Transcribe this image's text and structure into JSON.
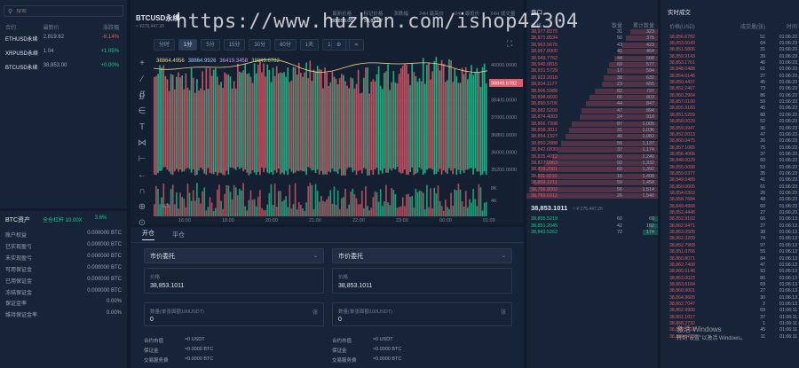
{
  "search": {
    "placeholder": "搜索"
  },
  "market": {
    "headers": [
      "合约",
      "最新价",
      "涨跌幅"
    ],
    "rows": [
      {
        "symbol": "ETHUSD永续",
        "price": "2,819.62",
        "change": "-6.14%",
        "dir": "down"
      },
      {
        "symbol": "XRPUSD永续",
        "price": "1.04",
        "change": "+1.05%",
        "dir": "up"
      },
      {
        "symbol": "BTCUSD永续",
        "price": "38,853.00",
        "change": "+0.00%",
        "dir": "up"
      }
    ]
  },
  "assets": {
    "title": "BTC资产",
    "stats": [
      "全仓杠杆 10.00X",
      "3.6%"
    ],
    "rows": [
      {
        "label": "账户权益",
        "value": "0.000000 BTC"
      },
      {
        "label": "已实现盈亏",
        "value": "0.000000 BTC"
      },
      {
        "label": "未实现盈亏",
        "value": "0.000000 BTC"
      },
      {
        "label": "可用保证金",
        "value": "0.000000 BTC"
      },
      {
        "label": "已用保证金",
        "value": "0.000000 BTC"
      },
      {
        "label": "冻结保证金",
        "value": "0.000000 BTC"
      },
      {
        "label": "保证金率",
        "value": "0.00%"
      },
      {
        "label": "维持保证金率",
        "value": "0.00%"
      }
    ]
  },
  "chart": {
    "symbol": "BTCUSD永续",
    "sub_price": "≈ ¥275,447.20",
    "header_stats": [
      "最新价格",
      "标记价格",
      "涨跌幅",
      "24H 最高价",
      "24H 最低价",
      "24H 成交量"
    ],
    "header_values": [
      "38,853.00",
      "38,852.7",
      "",
      "",
      "",
      ""
    ],
    "intervals": [
      "分时",
      "1分",
      "5分",
      "15分",
      "30分",
      "60分",
      "1天",
      "1周",
      "1月"
    ],
    "active_interval": "1分",
    "ma_values": [
      "38864.4956",
      "38864.9926",
      "36419.3458",
      "38849.6782"
    ],
    "ma_colors": [
      "#f0d38a",
      "#9ad1f5",
      "#d59cf0",
      "#8fe08a"
    ],
    "yaxis": [
      "40000.0000",
      "39200.0000",
      "38400.0000",
      "37600.0000",
      "36800.0000",
      "36000.0000",
      "35200.0000"
    ],
    "price_tag": "38849.6782",
    "xaxis": [
      "16:00",
      "18:00",
      "20:00",
      "21:00",
      "22:00",
      "23:00",
      "00:00",
      "01:00"
    ],
    "vol_axis": [
      "8K",
      "4K"
    ],
    "vol_label": "VOL"
  },
  "order": {
    "tabs": [
      "开仓",
      "平仓"
    ],
    "active_tab": "开仓",
    "forms": [
      {
        "type": "市价委托",
        "price_label": "价格",
        "price_value": "38,853.1011",
        "qty_label": "数量(单张面额100USDT)",
        "qty_value": "0",
        "qty_unit": "张",
        "info": [
          {
            "label": "合约市值",
            "value": "≈0 USDT"
          },
          {
            "label": "保证金",
            "value": "≈0.0000 BTC"
          },
          {
            "label": "交易服务费",
            "value": "≈0.0000 BTC"
          }
        ]
      },
      {
        "type": "市价委托",
        "price_label": "价格",
        "price_value": "38,853.1011",
        "qty_label": "数量(单张面额100USDT)",
        "qty_value": "0",
        "qty_unit": "张",
        "info": [
          {
            "label": "合约市值",
            "value": "≈0 USDT"
          },
          {
            "label": "保证金",
            "value": "≈0.0000 BTC"
          },
          {
            "label": "交易服务费",
            "value": "≈0.0000 BTC"
          }
        ]
      }
    ]
  },
  "book": {
    "title": "盘口",
    "headers": [
      "价格",
      "数量",
      "累计数量"
    ],
    "asks": [
      [
        "38,977.8375",
        "31",
        "323"
      ],
      [
        "38,971.8534",
        "50",
        "375"
      ],
      [
        "38,963.5675",
        "43",
        "423"
      ],
      [
        "38,957.8900",
        "41",
        "464"
      ],
      [
        "38,949.7762",
        "44",
        "508"
      ],
      [
        "38,940.0815",
        "69",
        "577"
      ],
      [
        "38,931.5729",
        "17",
        "594"
      ],
      [
        "38,922.2018",
        "38",
        "632"
      ],
      [
        "38,914.1177",
        "23",
        "655"
      ],
      [
        "38,906.5988",
        "82",
        "737"
      ],
      [
        "38,898.6690",
        "66",
        "803"
      ],
      [
        "38,890.5706",
        "44",
        "847"
      ],
      [
        "38,882.5200",
        "47",
        "894"
      ],
      [
        "38,874.4003",
        "24",
        "918"
      ],
      [
        "38,866.7398",
        "87",
        "1,005"
      ],
      [
        "38,858.3011",
        "31",
        "1,036"
      ],
      [
        "38,854.1327",
        "46",
        "1,082"
      ],
      [
        "38,850.2888",
        "55",
        "1,137"
      ],
      [
        "38,842.6830",
        "37",
        "1,174"
      ],
      [
        "38,835.4012",
        "66",
        "1,240"
      ],
      [
        "38,827.5963",
        "92",
        "1,332"
      ],
      [
        "38,819.2001",
        "60",
        "1,392"
      ],
      [
        "38,811.0210",
        "16",
        "1,408"
      ],
      [
        "38,803.1211",
        "50",
        "1,458"
      ],
      [
        "38,796.8002",
        "56",
        "1,514"
      ],
      [
        "38,789.0312",
        "26",
        "1,540"
      ]
    ],
    "last_price": "38,853.1011",
    "last_sub": "≈ ¥ 275,447.20",
    "bids": [
      [
        "38,855.5219",
        "60",
        "60"
      ],
      [
        "38,851.2045",
        "42",
        "102"
      ],
      [
        "38,843.5262",
        "72",
        "174"
      ]
    ]
  },
  "trades": {
    "title": "实时成交",
    "headers": [
      "价格(USD)",
      "成交量(张)",
      "时间"
    ],
    "rows": [
      [
        "38,856.6782",
        "51",
        "01:06:23"
      ],
      [
        "38,853.0049",
        "64",
        "01:06:23"
      ],
      [
        "38,851.5806",
        "31",
        "01:06:23"
      ],
      [
        "38,859.9143",
        "39",
        "01:06:23"
      ],
      [
        "38,853.1761",
        "46",
        "01:06:23"
      ],
      [
        "38,848.0488",
        "61",
        "01:06:23"
      ],
      [
        "38,854.0146",
        "27",
        "01:06:23"
      ],
      [
        "38,850.4437",
        "45",
        "01:06:23"
      ],
      [
        "38,852.2467",
        "73",
        "01:06:23"
      ],
      [
        "38,860.2964",
        "86",
        "01:06:23"
      ],
      [
        "38,857.0100",
        "59",
        "01:06:23"
      ],
      [
        "38,855.9183",
        "45",
        "01:06:23"
      ],
      [
        "38,851.5259",
        "88",
        "01:06:23"
      ],
      [
        "38,858.0029",
        "52",
        "01:06:23"
      ],
      [
        "38,859.0947",
        "36",
        "01:06:23"
      ],
      [
        "38,852.0013",
        "47",
        "01:06:23"
      ],
      [
        "38,860.0475",
        "26",
        "01:06:23"
      ],
      [
        "38,857.1065",
        "75",
        "01:06:23"
      ],
      [
        "38,856.4066",
        "37",
        "01:06:23"
      ],
      [
        "38,848.0029",
        "60",
        "01:06:23"
      ],
      [
        "38,855.0098",
        "53",
        "01:06:23"
      ],
      [
        "38,859.0377",
        "35",
        "01:06:23"
      ],
      [
        "38,849.0489",
        "41",
        "01:06:23"
      ],
      [
        "38,850.0005",
        "61",
        "01:06:23"
      ],
      [
        "38,854.0303",
        "26",
        "01:06:23"
      ],
      [
        "38,858.7684",
        "48",
        "01:06:23"
      ],
      [
        "38,849.4968",
        "60",
        "01:06:23"
      ],
      [
        "38,852.4448",
        "27",
        "01:06:23"
      ],
      [
        "38,852.9102",
        "66",
        "01:06:13"
      ],
      [
        "38,862.9471",
        "27",
        "01:06:13"
      ],
      [
        "38,863.0505",
        "38",
        "01:06:13"
      ],
      [
        "38,862.3209",
        "74",
        "01:06:13"
      ],
      [
        "38,852.7968",
        "97",
        "01:06:13"
      ],
      [
        "38,851.0766",
        "55",
        "01:06:13"
      ],
      [
        "38,860.8071",
        "84",
        "01:06:13"
      ],
      [
        "38,862.7408",
        "47",
        "01:06:13"
      ],
      [
        "38,865.5146",
        "93",
        "01:06:13"
      ],
      [
        "38,863.0023",
        "80",
        "01:06:13"
      ],
      [
        "38,863.6104",
        "69",
        "01:06:13"
      ],
      [
        "38,860.9001",
        "27",
        "01:06:13"
      ],
      [
        "38,864.9605",
        "30",
        "01:06:13"
      ],
      [
        "38,862.7047",
        "2",
        "01:06:13"
      ],
      [
        "38,862.9900",
        "69",
        "01:06:11"
      ],
      [
        "38,861.1017",
        "37",
        "01:06:11"
      ],
      [
        "38,868.2732",
        "1",
        "01:06:11"
      ],
      [
        "38,869.5218",
        "45",
        "01:06:11"
      ],
      [
        "38,869.5713",
        "11",
        "01:06:11"
      ]
    ]
  },
  "overlay": {
    "watermark": "https://www.huzhan.com/ishop42304",
    "windows_line1": "激活 Windows",
    "windows_line2": "转到\"设置\"以激活 Windows。"
  },
  "colors": {
    "up": "#1ec88f",
    "down": "#e25b6b",
    "bg": "#111a2a",
    "panel": "#172336"
  }
}
